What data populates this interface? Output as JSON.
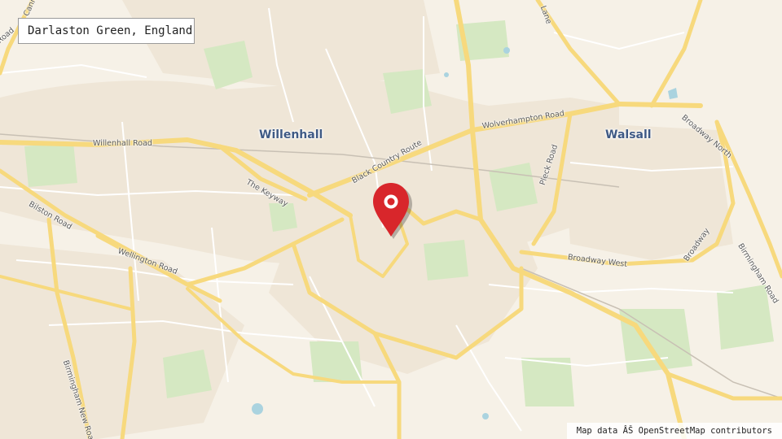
{
  "location_title": "Darlaston Green, England",
  "attribution": "Map data ÂŠ OpenStreetMap contributors",
  "colors": {
    "land": "#f6f1e7",
    "urban": "#efe6d7",
    "park": "#d5e8c2",
    "water": "#aad3df",
    "major_road": "#f7d97d",
    "minor_road": "#ffffff",
    "place_label": "#3f5a85",
    "marker": "#d8262b"
  },
  "places": {
    "willenhall": "Willenhall",
    "walsall": "Walsall"
  },
  "roads": {
    "willenhall_road": "Willenhall Road",
    "the_keyway": "The Keyway",
    "black_country_route": "Black Country Route",
    "wolverhampton_road": "Wolverhampton Road",
    "pleck_road": "Pleck Road",
    "broadway_north": "Broadway North",
    "broadway": "Broadway",
    "broadway_west": "Broadway West",
    "birmingham_road": "Birmingham Road",
    "bilston_road": "Bilston Road",
    "wellington_road": "Wellington Road",
    "birmingham_new_road": "Birmingham New Road",
    "lane_partial": "Lane",
    "road_partial": "Road",
    "cannock_partial": "Canno"
  },
  "marker": {
    "icon": "map-pin-icon"
  }
}
